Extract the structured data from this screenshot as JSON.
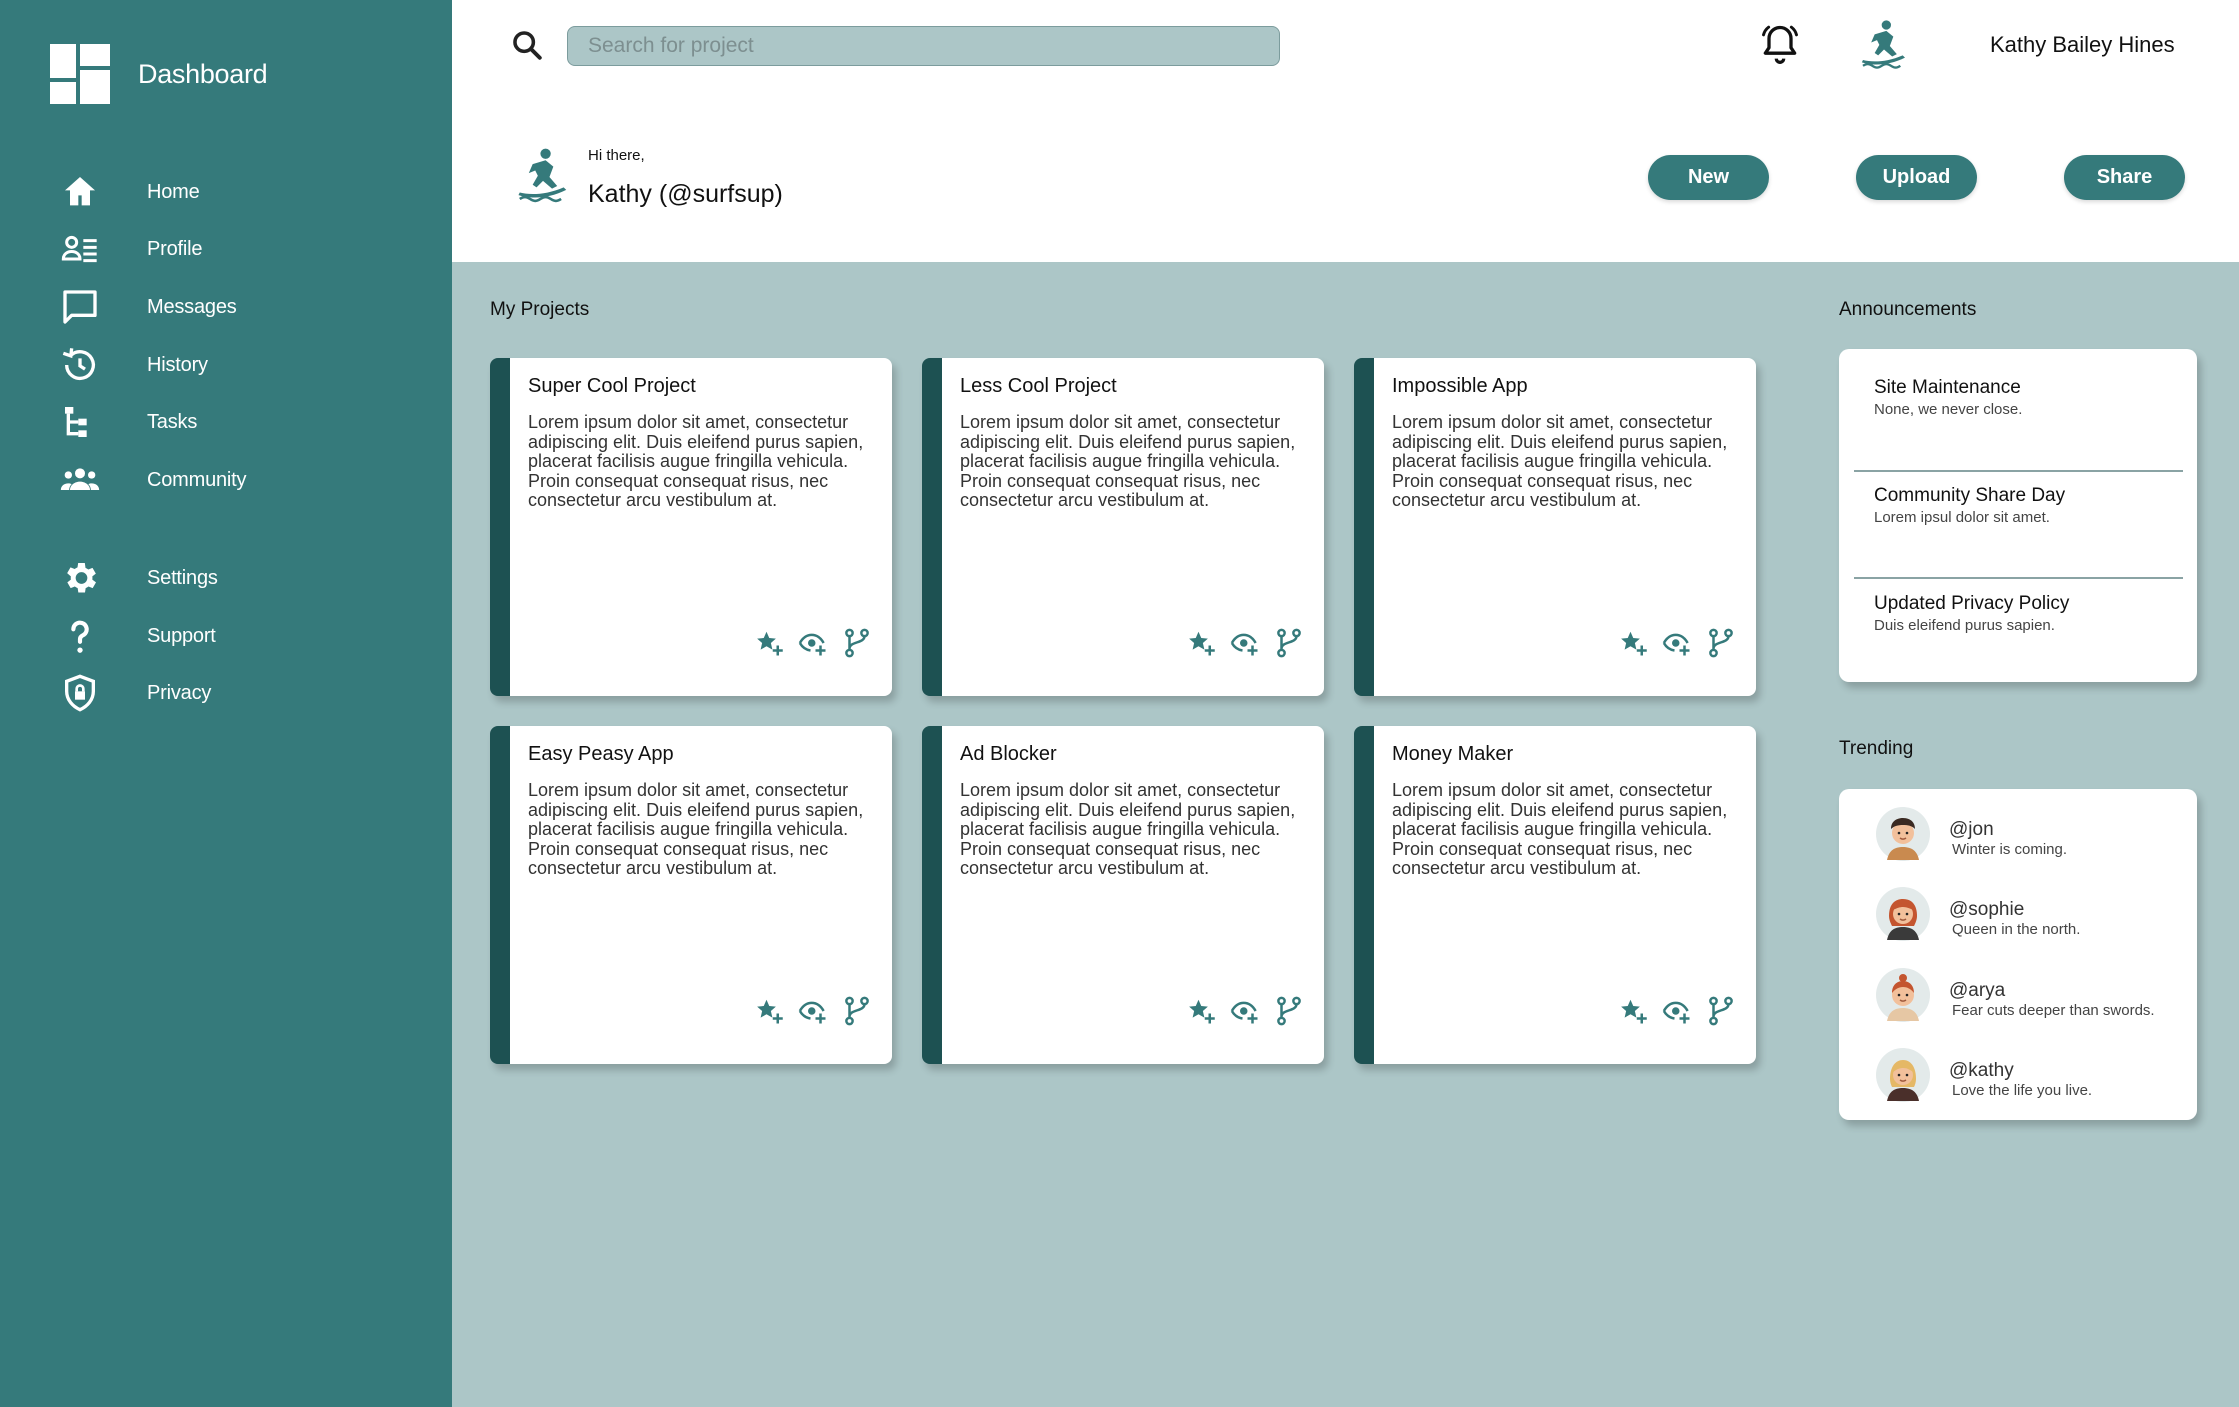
{
  "sidebar": {
    "title": "Dashboard",
    "items": [
      {
        "label": "Home",
        "icon": "home-icon"
      },
      {
        "label": "Profile",
        "icon": "profile-icon"
      },
      {
        "label": "Messages",
        "icon": "messages-icon"
      },
      {
        "label": "History",
        "icon": "history-icon"
      },
      {
        "label": "Tasks",
        "icon": "tasks-icon"
      },
      {
        "label": "Community",
        "icon": "community-icon"
      },
      {
        "label": "Settings",
        "icon": "gear-icon"
      },
      {
        "label": "Support",
        "icon": "question-icon"
      },
      {
        "label": "Privacy",
        "icon": "shield-lock-icon"
      }
    ]
  },
  "header": {
    "search_placeholder": "Search for project",
    "user_name": "Kathy Bailey Hines",
    "greeting": "Hi there,",
    "greeting_name": "Kathy (@surfsup)",
    "buttons": {
      "new": "New",
      "upload": "Upload",
      "share": "Share"
    }
  },
  "projects": {
    "title": "My Projects",
    "cards": [
      {
        "title": "Super Cool Project",
        "desc": "Lorem ipsum dolor sit amet, consectetur adipiscing elit. Duis eleifend purus sapien, placerat facilisis augue fringilla vehicula. Proin consequat consequat risus, nec consectetur arcu vestibulum at."
      },
      {
        "title": "Less Cool Project",
        "desc": "Lorem ipsum dolor sit amet, consectetur adipiscing elit. Duis eleifend purus sapien, placerat facilisis augue fringilla vehicula. Proin consequat consequat risus, nec consectetur arcu vestibulum at."
      },
      {
        "title": "Impossible App",
        "desc": "Lorem ipsum dolor sit amet, consectetur adipiscing elit. Duis eleifend purus sapien, placerat facilisis augue fringilla vehicula. Proin consequat consequat risus, nec consectetur arcu vestibulum at."
      },
      {
        "title": "Easy Peasy App",
        "desc": "Lorem ipsum dolor sit amet, consectetur adipiscing elit. Duis eleifend purus sapien, placerat facilisis augue fringilla vehicula. Proin consequat consequat risus, nec consectetur arcu vestibulum at."
      },
      {
        "title": "Ad Blocker",
        "desc": "Lorem ipsum dolor sit amet, consectetur adipiscing elit. Duis eleifend purus sapien, placerat facilisis augue fringilla vehicula. Proin consequat consequat risus, nec consectetur arcu vestibulum at."
      },
      {
        "title": "Money Maker",
        "desc": "Lorem ipsum dolor sit amet, consectetur adipiscing elit. Duis eleifend purus sapien, placerat facilisis augue fringilla vehicula. Proin consequat consequat risus, nec consectetur arcu vestibulum at."
      }
    ],
    "card_actions": [
      "star-add-icon",
      "watch-icon",
      "fork-icon"
    ]
  },
  "announcements": {
    "title": "Announcements",
    "items": [
      {
        "title": "Site Maintenance",
        "text": "None, we never close."
      },
      {
        "title": "Community Share Day",
        "text": "Lorem ipsul dolor sit amet."
      },
      {
        "title": "Updated Privacy Policy",
        "text": "Duis eleifend purus sapien."
      }
    ]
  },
  "trending": {
    "title": "Trending",
    "items": [
      {
        "handle": "@jon",
        "text": "Winter is coming."
      },
      {
        "handle": "@sophie",
        "text": "Queen in the north."
      },
      {
        "handle": "@arya",
        "text": "Fear cuts deeper than swords."
      },
      {
        "handle": "@kathy",
        "text": "Love the life you live."
      }
    ]
  },
  "colors": {
    "sidebar": "#357a7b",
    "card_accent": "#1d5152",
    "background": "#acc6c7",
    "button": "#357a7b"
  }
}
